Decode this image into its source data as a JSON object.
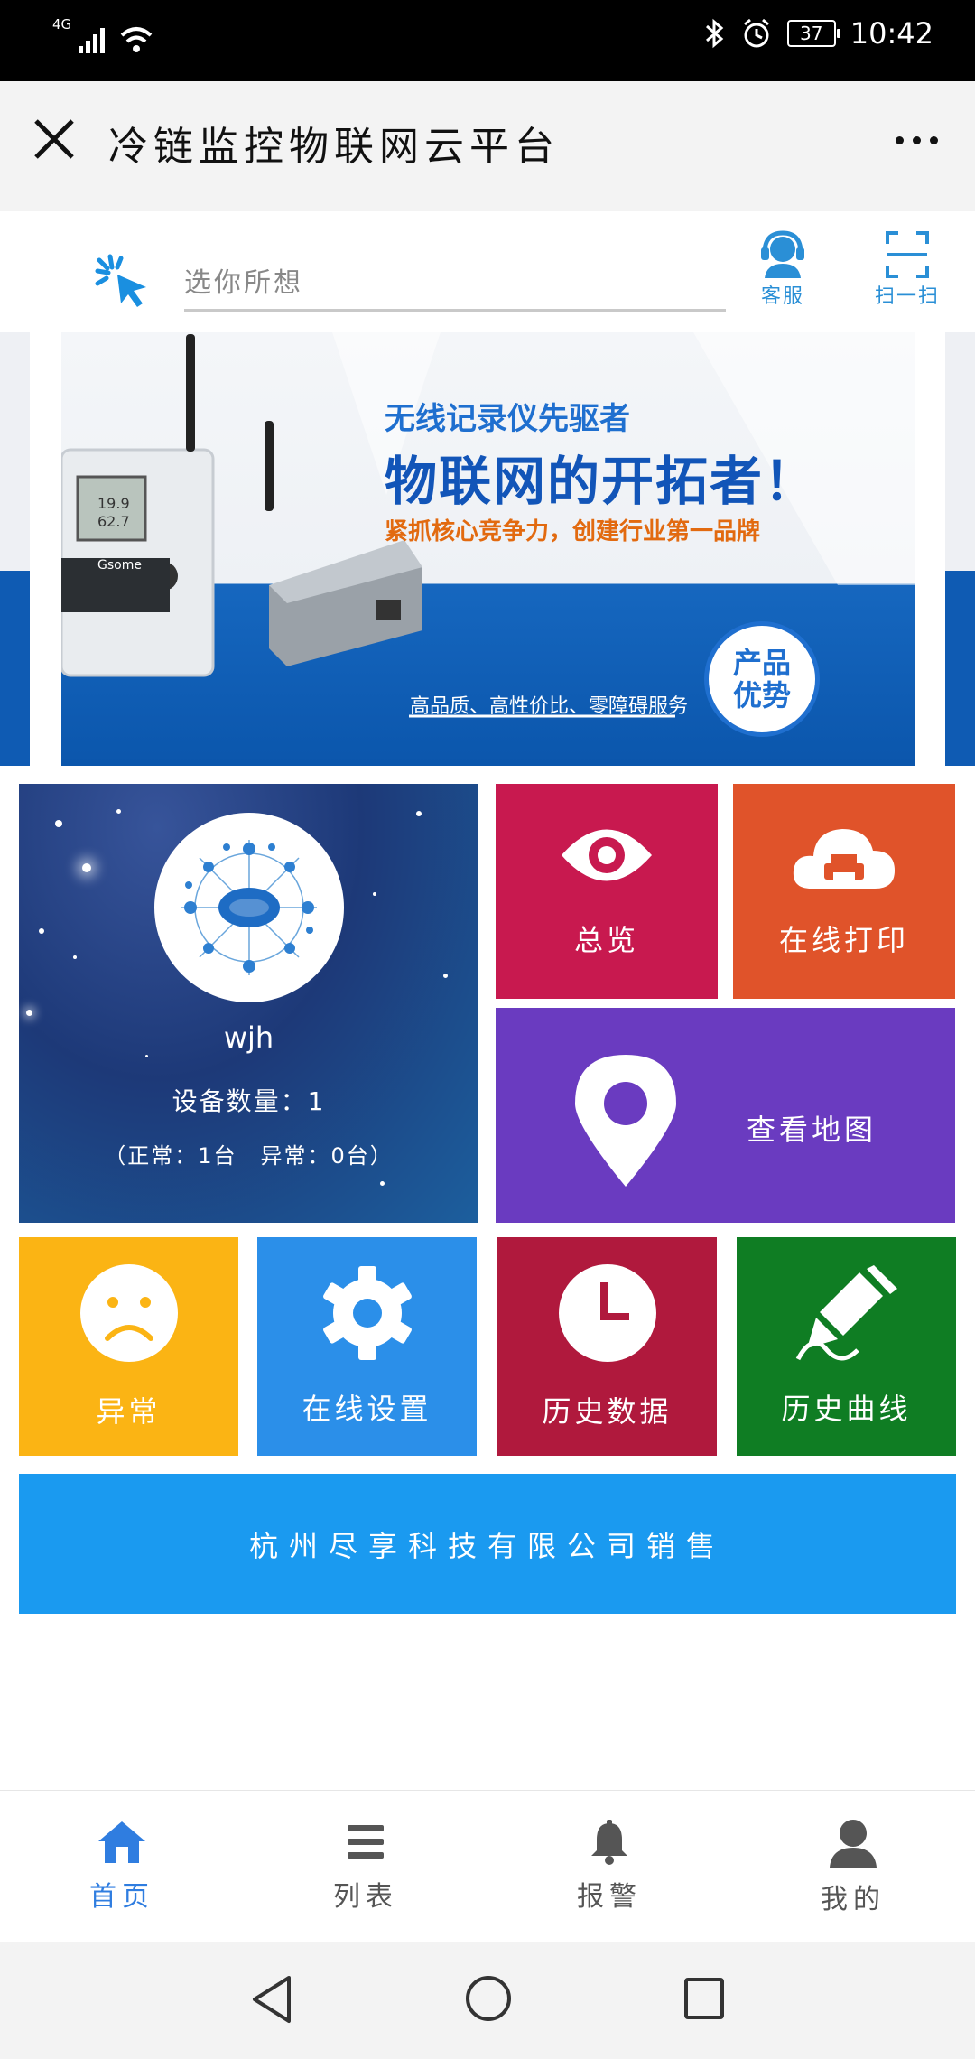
{
  "status_bar": {
    "network": "4G",
    "battery": "37",
    "time": "10:42"
  },
  "title_bar": {
    "title": "冷链监控物联网云平台"
  },
  "search": {
    "placeholder": "选你所想"
  },
  "top_actions": [
    {
      "label": "客服",
      "icon": "headset-icon"
    },
    {
      "label": "扫一扫",
      "icon": "scan-icon"
    }
  ],
  "banner": {
    "line1_prefix": "无线",
    "line1_highlight": "记录仪先驱者",
    "line2": "物联网的开拓者！",
    "line3": "紧抓核心竞争力，创建行业第一品牌",
    "line4": "高品质、高性价比、零障碍服务",
    "badge_line1": "产品",
    "badge_line2": "优势",
    "device_display_1": "19.9",
    "device_display_2": "62.7",
    "brand": "Gsome"
  },
  "user_card": {
    "name": "wjh",
    "device_count": "设备数量：1",
    "status": "（正常：1台　异常：0台）"
  },
  "tiles": [
    {
      "label": "总览",
      "color": "#c8194f",
      "icon": "eye-icon"
    },
    {
      "label": "在线打印",
      "color": "#e0532a",
      "icon": "cloud-print-icon"
    },
    {
      "label": "查看地图",
      "color": "#6a3bc0",
      "icon": "map-pin-icon"
    },
    {
      "label": "异常",
      "color": "#fbb414",
      "icon": "sad-face-icon"
    },
    {
      "label": "在线设置",
      "color": "#2b8fe9",
      "icon": "gear-icon"
    },
    {
      "label": "历史数据",
      "color": "#b0193d",
      "icon": "clock-icon"
    },
    {
      "label": "历史曲线",
      "color": "#0f7d23",
      "icon": "pen-curve-icon"
    }
  ],
  "footer_text": "杭州尽享科技有限公司销售",
  "bottom_nav": [
    {
      "label": "首页",
      "icon": "home-icon",
      "active": true
    },
    {
      "label": "列表",
      "icon": "list-icon",
      "active": false
    },
    {
      "label": "报警",
      "icon": "bell-icon",
      "active": false
    },
    {
      "label": "我的",
      "icon": "user-icon",
      "active": false
    }
  ],
  "colors": {
    "accent": "#2f7de0",
    "footer_bar": "#1a9af0"
  }
}
